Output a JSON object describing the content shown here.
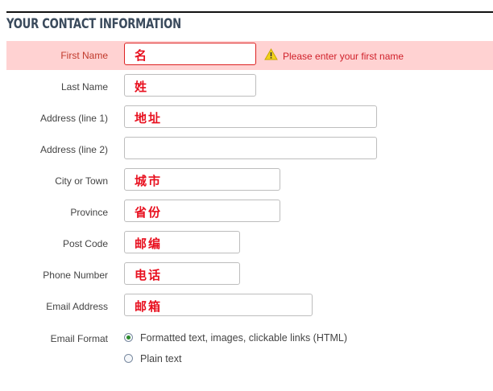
{
  "section": {
    "title": "YOUR CONTACT INFORMATION"
  },
  "fields": {
    "first_name": {
      "label": "First Name",
      "value": "名",
      "error": "Please enter your first name"
    },
    "last_name": {
      "label": "Last Name",
      "value": "姓"
    },
    "address1": {
      "label": "Address (line 1)",
      "value": "地址"
    },
    "address2": {
      "label": "Address (line 2)",
      "value": ""
    },
    "city": {
      "label": "City or Town",
      "value": "城市"
    },
    "province": {
      "label": "Province",
      "value": "省份"
    },
    "post_code": {
      "label": "Post Code",
      "value": "邮编"
    },
    "phone": {
      "label": "Phone Number",
      "value": "电话"
    },
    "email": {
      "label": "Email Address",
      "value": "邮箱"
    }
  },
  "email_format": {
    "label": "Email Format",
    "options": [
      {
        "label": "Formatted text, images, clickable links (HTML)",
        "selected": true
      },
      {
        "label": "Plain text",
        "selected": false
      }
    ]
  },
  "icons": {
    "error": "warning-icon"
  },
  "colors": {
    "error_bg": "#ffd2d2",
    "error_text": "#d0202a",
    "value_text": "#e8101f",
    "title": "#3a4a5c"
  }
}
